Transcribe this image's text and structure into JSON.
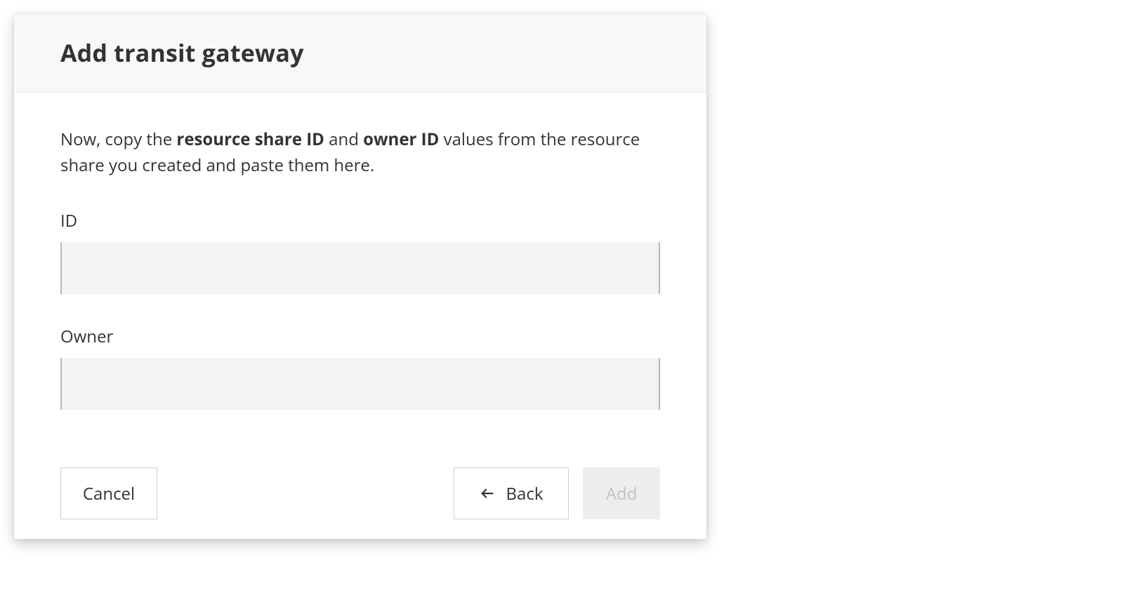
{
  "modal": {
    "title": "Add transit gateway",
    "instruction_parts": {
      "pre": "Now, copy the ",
      "bold1": "resource share ID",
      "mid": " and ",
      "bold2": "owner ID",
      "post": " values from the resource share you created and paste them here."
    },
    "fields": {
      "id": {
        "label": "ID",
        "value": ""
      },
      "owner": {
        "label": "Owner",
        "value": ""
      }
    },
    "buttons": {
      "cancel": "Cancel",
      "back": "Back",
      "add": "Add"
    },
    "icons": {
      "back_arrow": "arrow-left"
    }
  }
}
